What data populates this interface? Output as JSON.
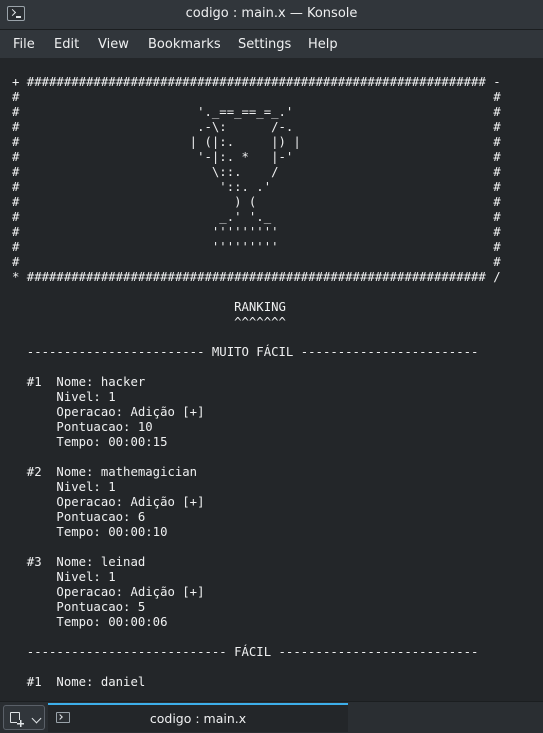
{
  "window": {
    "title": "codigo : main.x — Konsole",
    "app_icon": "terminal-icon"
  },
  "menubar": {
    "items": [
      "File",
      "Edit",
      "View",
      "Bookmarks",
      "Settings",
      "Help"
    ]
  },
  "terminal": {
    "content": "+ ############################################################## -\n#                                                                #\n#                        '._==_==_=_.'                           #\n#                        .-\\:      /-.                           #\n#                       | (|:.     |) |                          #\n#                        '-|:. *   |-'                           #\n#                          \\::.    /                             #\n#                           '::. .'                              #\n#                             ) (                                #\n#                           _.' '._                              #\n#                          '''''''''                             #\n#                          '''''''''                             #\n#                                                                #\n* ############################################################## /\n\n                              RANKING\n                              ^^^^^^^\n\n  ------------------------ MUITO FÁCIL ------------------------\n\n  #1  Nome: hacker\n      Nivel: 1\n      Operacao: Adição [+]\n      Pontuacao: 10\n      Tempo: 00:00:15\n\n  #2  Nome: mathemagician\n      Nivel: 1\n      Operacao: Adição [+]\n      Pontuacao: 6\n      Tempo: 00:00:10\n\n  #3  Nome: leinad\n      Nivel: 1\n      Operacao: Adição [+]\n      Pontuacao: 5\n      Tempo: 00:00:06\n\n  --------------------------- FÁCIL ---------------------------\n\n  #1  Nome: daniel"
  },
  "tabbar": {
    "new_tab_icon": "new-tab-icon",
    "tabs": [
      {
        "label": "codigo : main.x",
        "icon": "terminal-icon",
        "active": true
      }
    ]
  }
}
